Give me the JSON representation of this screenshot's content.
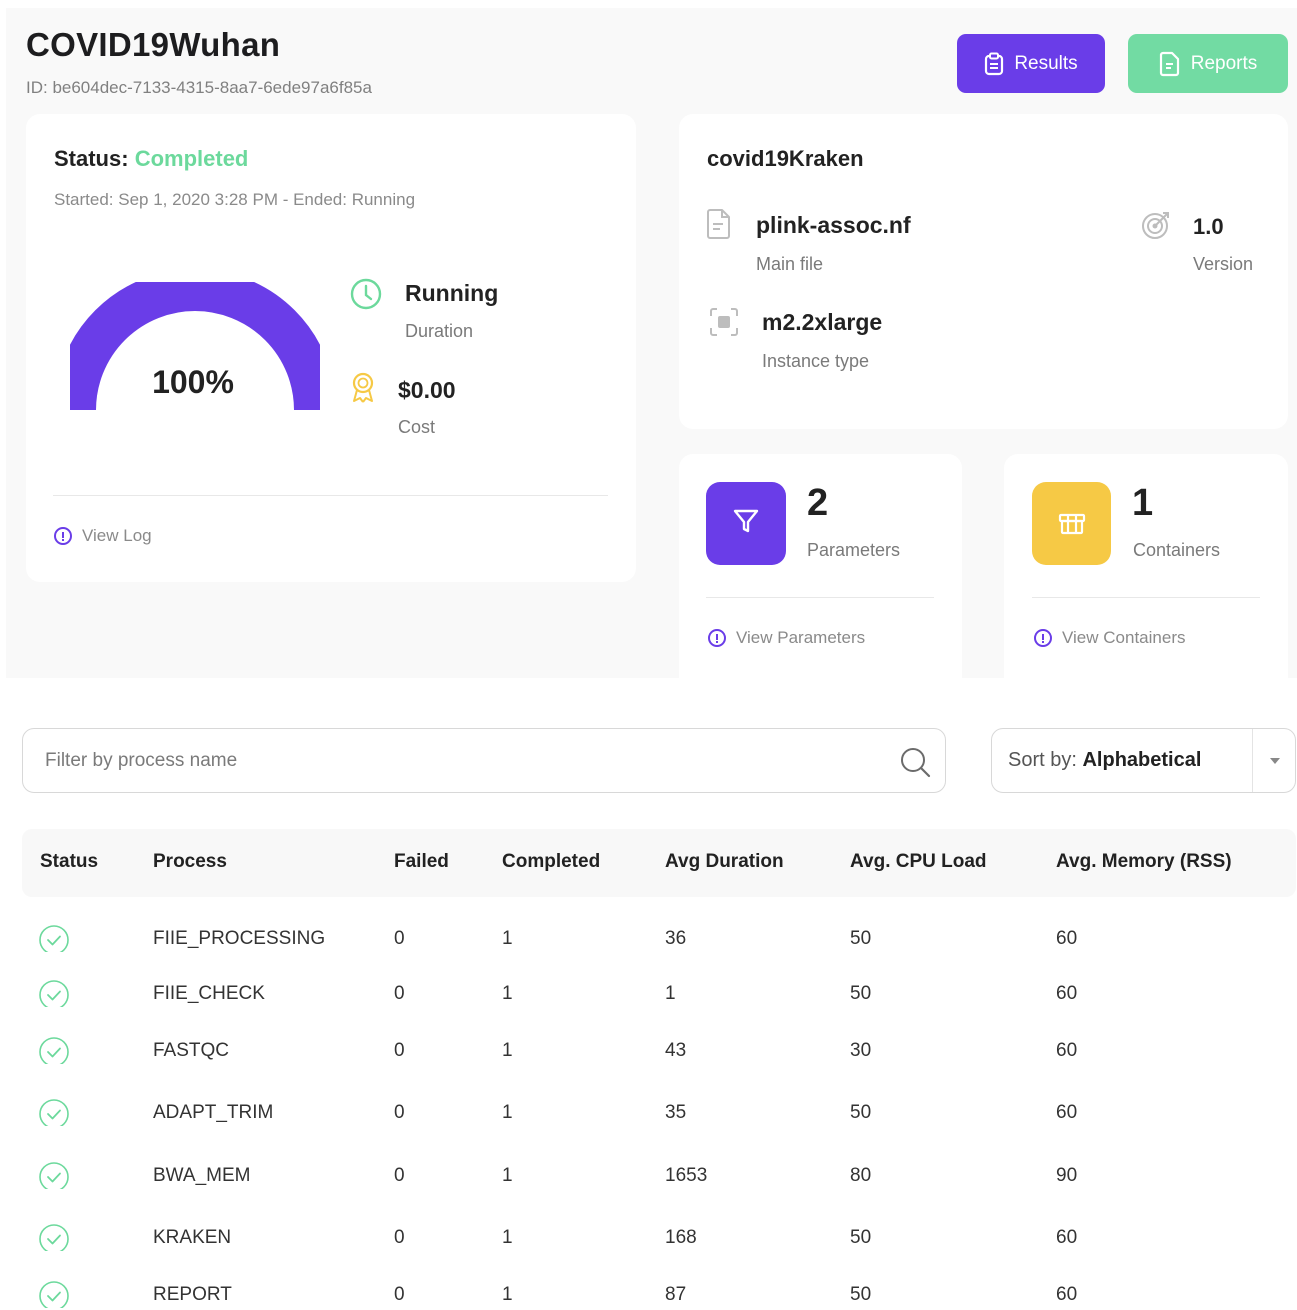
{
  "header": {
    "title": "COVID19Wuhan",
    "id_text": "ID: be604dec-7133-4315-8aa7-6ede97a6f85a",
    "results_label": "Results",
    "reports_label": "Reports"
  },
  "status_card": {
    "status_prefix": "Status: ",
    "status_value": "Completed",
    "started_text": "Started: Sep 1, 2020 3:28 PM - Ended: Running",
    "progress_percent": 100,
    "progress_label": "100%",
    "duration_value": "Running",
    "duration_label": "Duration",
    "cost_value": "$0.00",
    "cost_label": "Cost",
    "view_log_label": "View Log"
  },
  "pipeline_card": {
    "name": "covid19Kraken",
    "main_file_value": "plink-assoc.nf",
    "main_file_label": "Main file",
    "version_value": "1.0",
    "version_label": "Version",
    "instance_value": "m2.2xlarge",
    "instance_label": "Instance type"
  },
  "parameters_card": {
    "count": "2",
    "label": "Parameters",
    "link_label": "View Parameters"
  },
  "containers_card": {
    "count": "1",
    "label": "Containers",
    "link_label": "View Containers"
  },
  "filter": {
    "placeholder": "Filter by process name",
    "value": ""
  },
  "sort": {
    "prefix": "Sort by: ",
    "value": "Alphabetical"
  },
  "table": {
    "headers": [
      "Status",
      "Process",
      "Failed",
      "Completed",
      "Avg Duration",
      "Avg. CPU Load",
      "Avg. Memory (RSS)"
    ],
    "rows": [
      {
        "process": "FIIE_PROCESSING",
        "failed": "0",
        "completed": "1",
        "duration": "36",
        "cpu": "50",
        "memory": "60"
      },
      {
        "process": "FIIE_CHECK",
        "failed": "0",
        "completed": "1",
        "duration": "1",
        "cpu": "50",
        "memory": "60"
      },
      {
        "process": "FASTQC",
        "failed": "0",
        "completed": "1",
        "duration": "43",
        "cpu": "30",
        "memory": "60"
      },
      {
        "process": "ADAPT_TRIM",
        "failed": "0",
        "completed": "1",
        "duration": "35",
        "cpu": "50",
        "memory": "60"
      },
      {
        "process": "BWA_MEM",
        "failed": "0",
        "completed": "1",
        "duration": "1653",
        "cpu": "80",
        "memory": "90"
      },
      {
        "process": "KRAKEN",
        "failed": "0",
        "completed": "1",
        "duration": "168",
        "cpu": "50",
        "memory": "60"
      },
      {
        "process": "REPORT",
        "failed": "0",
        "completed": "1",
        "duration": "87",
        "cpu": "50",
        "memory": "60"
      }
    ]
  },
  "colors": {
    "accent_purple": "#6a3de8",
    "success_green": "#6cd99c",
    "reports_green": "#72dba3",
    "containers_yellow": "#f6c945"
  },
  "icons": {
    "results": "clipboard-icon",
    "reports": "document-icon",
    "duration": "clock-icon",
    "cost": "award-icon",
    "main_file": "file-icon",
    "version": "target-icon",
    "instance": "chip-icon",
    "parameters": "filter-icon",
    "containers": "gift-box-icon",
    "search": "search-icon",
    "row_status": "check-circle-icon"
  }
}
